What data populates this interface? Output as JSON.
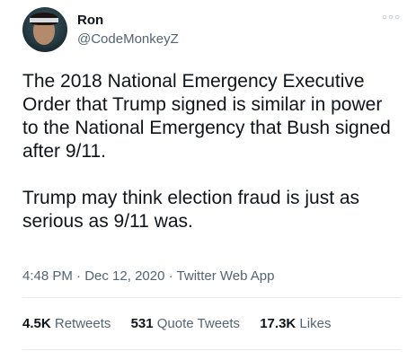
{
  "author": {
    "name": "Ron",
    "handle": "@CodeMonkeyZ"
  },
  "menu_icon": "more-options-icon",
  "text": {
    "paragraph1": "The 2018 National Emergency Executive Order that Trump signed is similar in power to the National Emergency that Bush signed after 9/11.",
    "paragraph2": "Trump may think election fraud is just as serious as 9/11 was."
  },
  "meta": {
    "time": "4:48 PM",
    "date": "Dec 12, 2020",
    "source": "Twitter Web App",
    "separator": "·"
  },
  "stats": {
    "retweets": {
      "count": "4.5K",
      "label": "Retweets"
    },
    "quote_tweets": {
      "count": "531",
      "label": "Quote Tweets"
    },
    "likes": {
      "count": "17.3K",
      "label": "Likes"
    }
  }
}
